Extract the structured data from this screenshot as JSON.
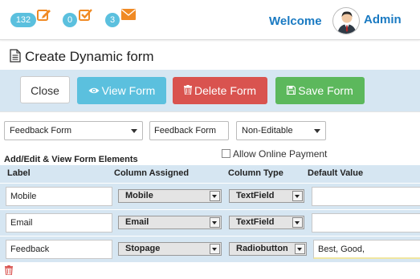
{
  "header": {
    "badges": [
      {
        "count": "132",
        "icon": "edit-icon"
      },
      {
        "count": "0",
        "icon": "check-square-icon"
      },
      {
        "count": "3",
        "icon": "envelope-icon"
      }
    ],
    "welcome": "Welcome",
    "user": "Admin"
  },
  "page": {
    "title": "Create Dynamic form"
  },
  "toolbar": {
    "close_label": "Close",
    "view_label": "View Form",
    "delete_label": "Delete Form",
    "save_label": "Save Form"
  },
  "form": {
    "form_select": "Feedback Form",
    "form_name": "Feedback Form",
    "edit_mode": "Non-Editable",
    "section_label": "Add/Edit & View Form Elements",
    "allow_payment_label": "Allow Online Payment",
    "allow_payment_checked": false
  },
  "table": {
    "headers": [
      "Label",
      "Column Assigned",
      "Column Type",
      "Default Value"
    ],
    "rows": [
      {
        "label": "Mobile",
        "column": "Mobile",
        "type": "TextField",
        "default": ""
      },
      {
        "label": "Email",
        "column": "Email",
        "type": "TextField",
        "default": ""
      },
      {
        "label": "Feedback",
        "column": "Stopage",
        "type": "Radiobutton",
        "default": "Best, Good,"
      }
    ]
  },
  "colors": {
    "accent_blue": "#1a7ac2",
    "badge": "#5bc0de",
    "icon_orange": "#f08a24",
    "view_button": "#5bc0de",
    "delete_button": "#d9534f",
    "save_button": "#5cb85c",
    "toolbar_bg": "#d6e6f2",
    "trash": "#d9534f"
  }
}
